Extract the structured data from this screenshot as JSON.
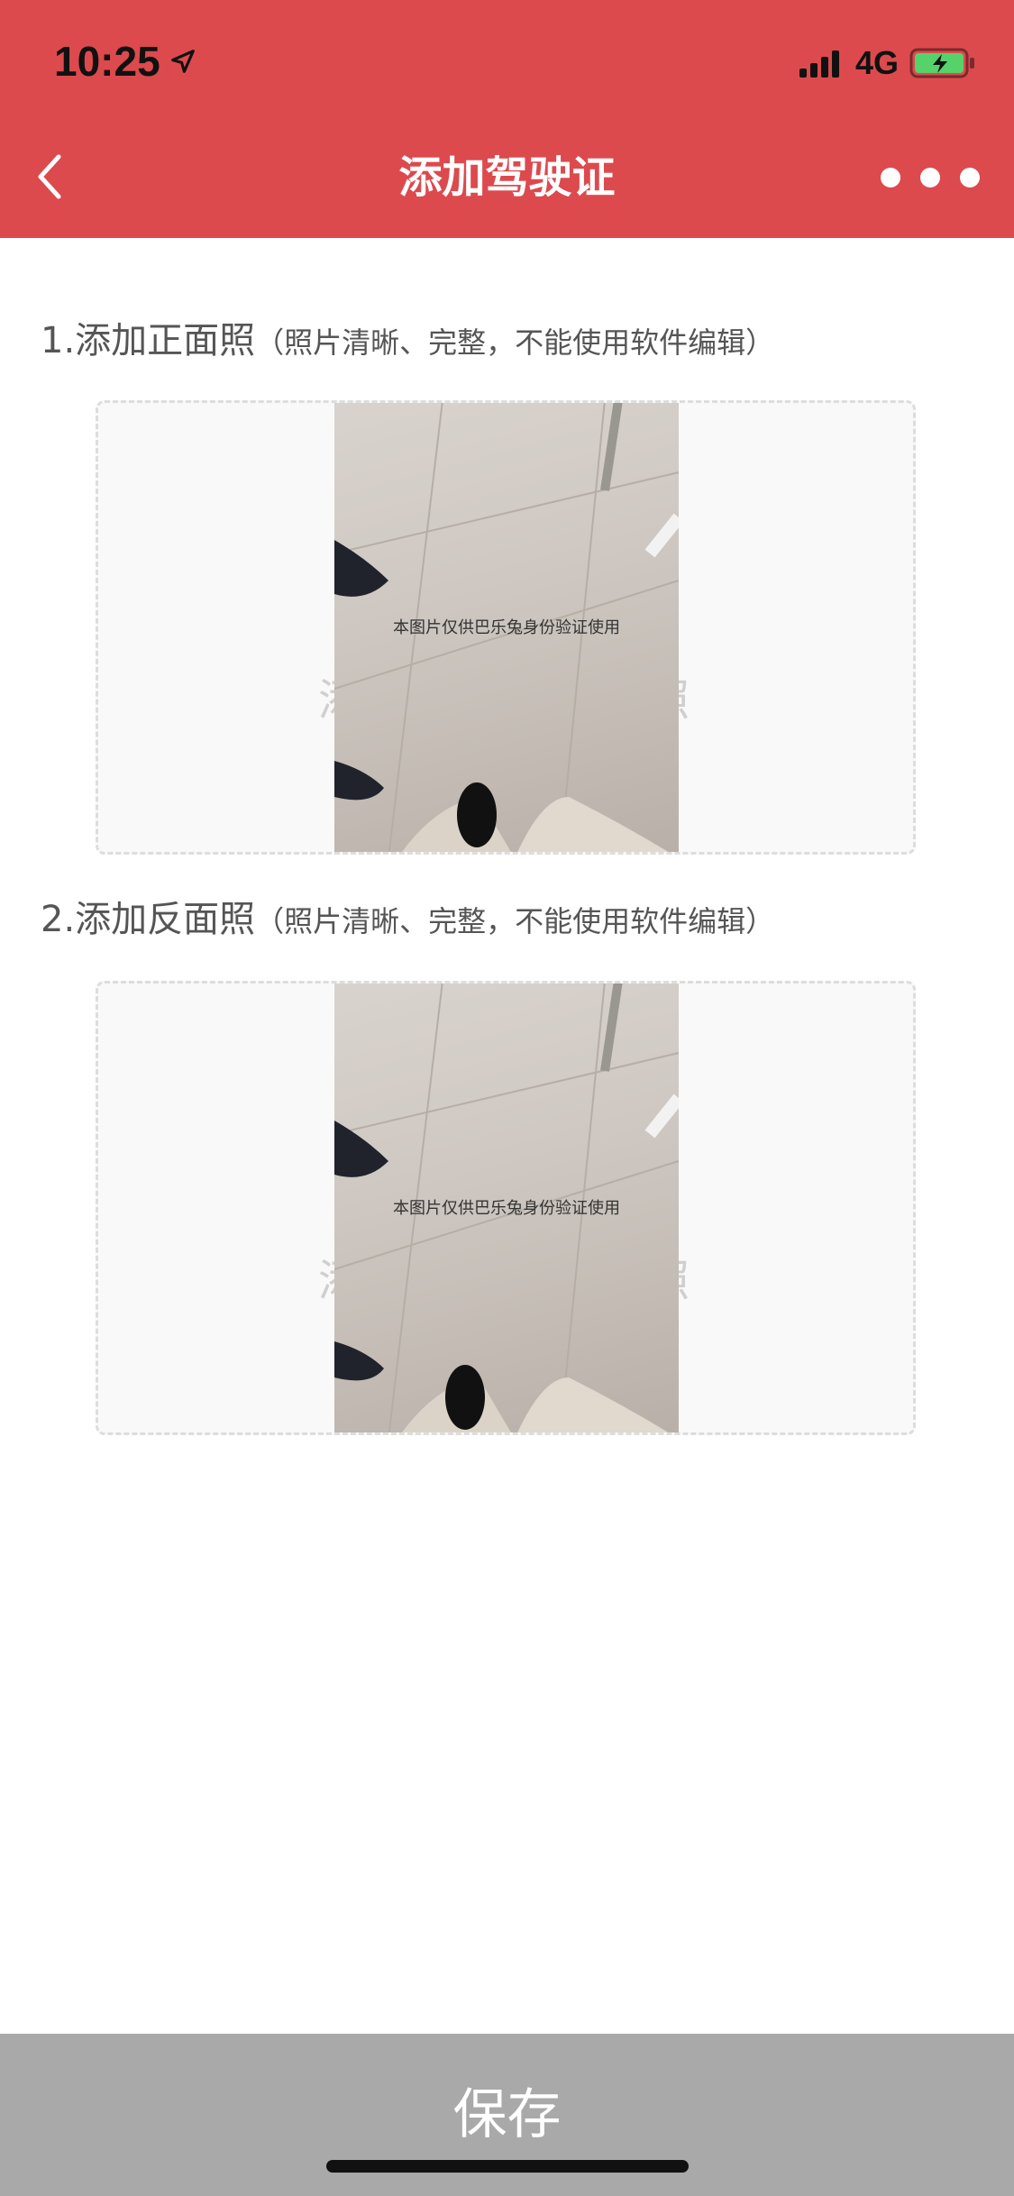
{
  "status_bar": {
    "time": "10:25",
    "network": "4G",
    "location_icon": "location-arrow-icon",
    "signal_icon": "cellular-signal-icon",
    "battery_icon": "battery-charging-icon"
  },
  "nav": {
    "title": "添加驾驶证",
    "back_icon": "chevron-left-icon",
    "more_icon": "more-dots-icon"
  },
  "sections": [
    {
      "title": "1.添加正面照",
      "hint": "（照片清晰、完整，不能使用软件编辑）",
      "placeholder": "添加驾驶证正面照",
      "photo_watermark": "本图片仅供巴乐兔身份验证使用"
    },
    {
      "title": "2.添加反面照",
      "hint": "（照片清晰、完整，不能使用软件编辑）",
      "placeholder": "添加驾驶证反面照",
      "photo_watermark": "本图片仅供巴乐兔身份验证使用"
    }
  ],
  "footer": {
    "save_label": "保存"
  },
  "colors": {
    "header_bg": "#dc4a4e",
    "save_bar_bg": "#a9a9a9"
  }
}
